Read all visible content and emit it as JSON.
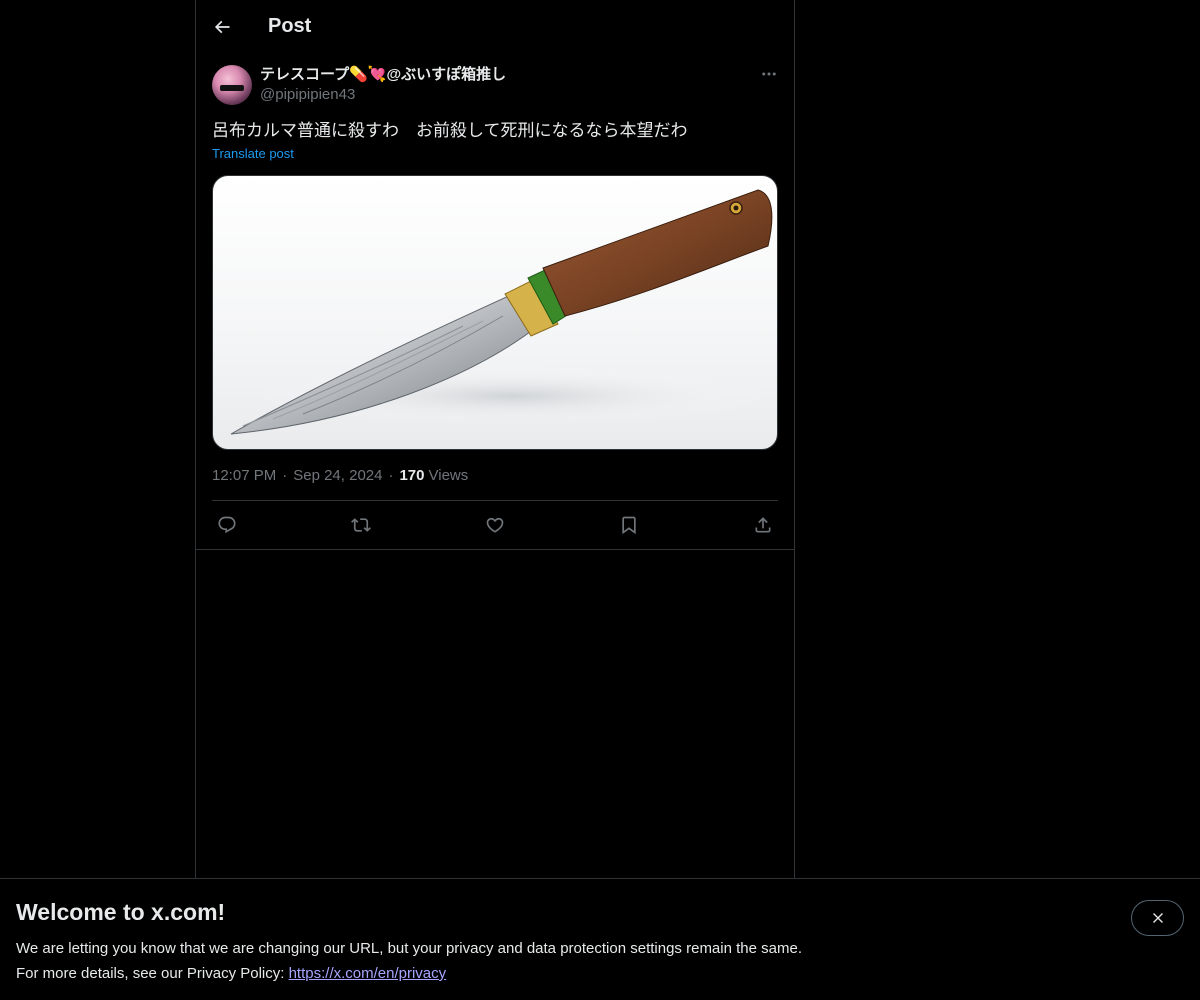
{
  "header": {
    "title": "Post"
  },
  "post": {
    "author": {
      "display_name": "テレスコープ💊💘@ぶいすぽ箱推し",
      "handle": "@pipipipien43"
    },
    "text": "呂布カルマ普通に殺すわ　お前殺して死刑になるなら本望だわ",
    "translate_label": "Translate post",
    "time": "12:07 PM",
    "date": "Sep 24, 2024",
    "views_count": "170",
    "views_label": "Views",
    "separator": "·"
  },
  "icons": {
    "back": "arrow-left-icon",
    "more": "more-horizontal-icon",
    "reply": "reply-icon",
    "repost": "repost-icon",
    "like": "heart-icon",
    "bookmark": "bookmark-icon",
    "share": "share-icon",
    "close": "close-icon"
  },
  "banner": {
    "title": "Welcome to x.com!",
    "line1": "We are letting you know that we are changing our URL, but your privacy and data protection settings remain the same.",
    "line2_prefix": "For more details, see our Privacy Policy: ",
    "link": "https://x.com/en/privacy"
  },
  "colors": {
    "background": "#000000",
    "text": "#e7e9ea",
    "muted": "#71767b",
    "accent": "#1d9bf0",
    "border": "#2f3336",
    "link": "#a7a5ff"
  }
}
